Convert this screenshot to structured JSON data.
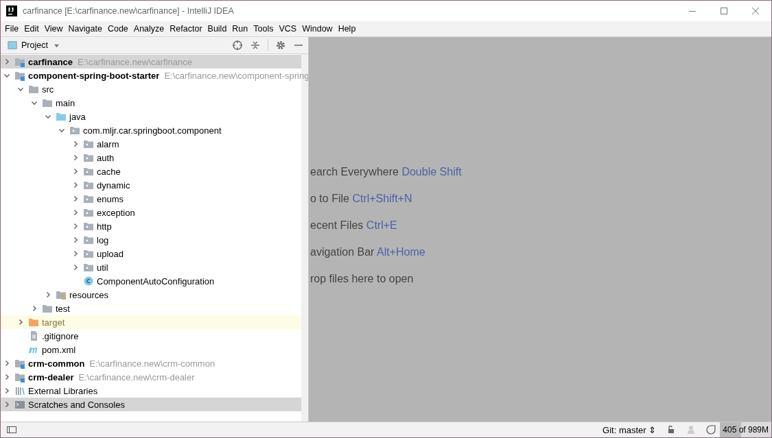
{
  "window": {
    "title": "carfinance [E:\\carfinance.new\\carfinance] - IntelliJ IDEA"
  },
  "menu": [
    "File",
    "Edit",
    "View",
    "Navigate",
    "Code",
    "Analyze",
    "Refactor",
    "Build",
    "Run",
    "Tools",
    "VCS",
    "Window",
    "Help"
  ],
  "project_panel": {
    "title": "Project",
    "tree": [
      {
        "name": "carfinance",
        "path": "E:\\carfinance.new\\carfinance",
        "kind": "module",
        "expanded": false,
        "selected": true
      },
      {
        "name": "component-spring-boot-starter",
        "path": "E:\\carfinance.new\\component-spring",
        "kind": "module",
        "expanded": true,
        "selected": false,
        "children": [
          {
            "name": "src",
            "kind": "folder",
            "expanded": true,
            "selected": false,
            "children": [
              {
                "name": "main",
                "kind": "folder",
                "expanded": true,
                "selected": false,
                "children": [
                  {
                    "name": "java",
                    "kind": "source-folder",
                    "expanded": true,
                    "selected": false,
                    "children": [
                      {
                        "name": "com.mljr.car.springboot.component",
                        "kind": "package",
                        "expanded": true,
                        "selected": false,
                        "children": [
                          {
                            "name": "alarm",
                            "kind": "package",
                            "expanded": false,
                            "selected": false
                          },
                          {
                            "name": "auth",
                            "kind": "package",
                            "expanded": false,
                            "selected": false
                          },
                          {
                            "name": "cache",
                            "kind": "package",
                            "expanded": false,
                            "selected": false
                          },
                          {
                            "name": "dynamic",
                            "kind": "package",
                            "expanded": false,
                            "selected": false
                          },
                          {
                            "name": "enums",
                            "kind": "package",
                            "expanded": false,
                            "selected": false
                          },
                          {
                            "name": "exception",
                            "kind": "package",
                            "expanded": false,
                            "selected": false
                          },
                          {
                            "name": "http",
                            "kind": "package",
                            "expanded": false,
                            "selected": false
                          },
                          {
                            "name": "log",
                            "kind": "package",
                            "expanded": false,
                            "selected": false
                          },
                          {
                            "name": "upload",
                            "kind": "package",
                            "expanded": false,
                            "selected": false
                          },
                          {
                            "name": "util",
                            "kind": "package",
                            "expanded": false,
                            "selected": false
                          },
                          {
                            "name": "ComponentAutoConfiguration",
                            "kind": "class",
                            "selected": false
                          }
                        ]
                      }
                    ]
                  },
                  {
                    "name": "resources",
                    "kind": "resources-folder",
                    "expanded": false,
                    "selected": false
                  }
                ]
              },
              {
                "name": "test",
                "kind": "folder",
                "expanded": false,
                "selected": false
              }
            ]
          },
          {
            "name": "target",
            "kind": "excluded-folder",
            "expanded": false,
            "selected": false
          },
          {
            "name": ".gitignore",
            "kind": "text-file",
            "selected": false
          },
          {
            "name": "pom.xml",
            "kind": "maven-file",
            "selected": false
          }
        ]
      },
      {
        "name": "crm-common",
        "path": "E:\\carfinance.new\\crm-common",
        "kind": "module",
        "expanded": false,
        "selected": false
      },
      {
        "name": "crm-dealer",
        "path": "E:\\carfinance.new\\crm-dealer",
        "kind": "module",
        "expanded": false,
        "selected": false
      },
      {
        "name": "External Libraries",
        "kind": "libraries",
        "expanded": false,
        "selected": false
      },
      {
        "name": "Scratches and Consoles",
        "kind": "scratches",
        "expanded": false,
        "selected": true
      }
    ]
  },
  "editor_hints": [
    {
      "action": "earch Everywhere",
      "shortcut": "Double Shift"
    },
    {
      "action": "o to File",
      "shortcut": "Ctrl+Shift+N"
    },
    {
      "action": "ecent Files",
      "shortcut": "Ctrl+E"
    },
    {
      "action": "avigation Bar",
      "shortcut": "Alt+Home"
    },
    {
      "action": "rop files here to open"
    }
  ],
  "status_bar": {
    "branch": "Git: master ⇕",
    "memory": "405 of 989M",
    "memory_used": {
      "level": 0.41
    }
  }
}
